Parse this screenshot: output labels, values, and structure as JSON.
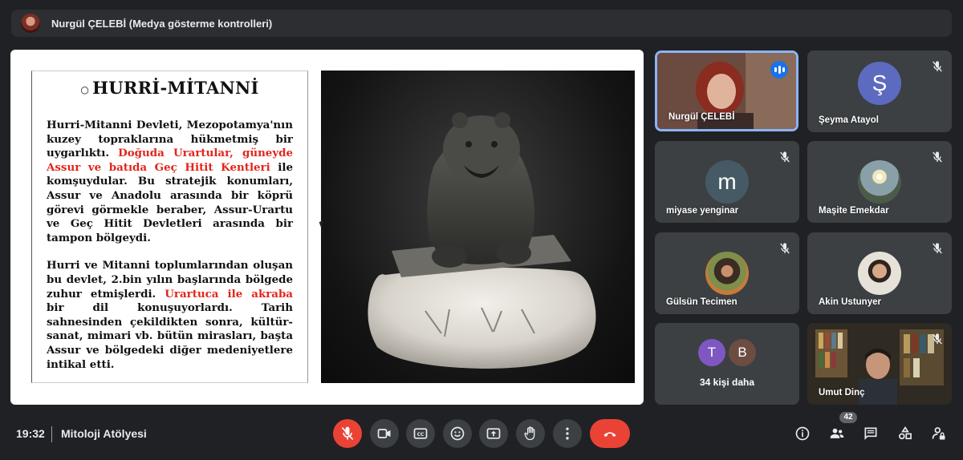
{
  "presenter_bar": {
    "title": "Nurgül ÇELEBİ (Medya gösterme kontrolleri)"
  },
  "slide": {
    "heading": "HURRİ-MİTANNİ",
    "para1": [
      {
        "text": "Hurri-Mitanni Devleti, Mezopotamya'nın kuzey topraklarına hükmetmiş bir uygarlıktı. ",
        "red": false
      },
      {
        "text": "Doğuda Urartular, güneyde Assur ve batıda Geç Hitit Kentleri",
        "red": true
      },
      {
        "text": " ile komşuydular. Bu stratejik konumları, Assur ve Anadolu arasında bir köprü görevi görmekle beraber, Assur-Urartu ve Geç Hitit Devletleri arasında bir tampon bölgeydi.",
        "red": false
      }
    ],
    "para2": [
      {
        "text": "Hurri ve Mitanni toplumlarından oluşan bu devlet, 2.bin yılın başlarında bölgede zuhur etmişlerdi. ",
        "red": false
      },
      {
        "text": "Urartuca ile akraba",
        "red": true
      },
      {
        "text": " bir dil konuşuyorlardı. Tarih sahnesinden çekildikten sonra, kültür-sanat, mimari vb. bütün mirasları, başta Assur ve bölgedeki diğer medeniyetlere intikal etti.",
        "red": false
      }
    ]
  },
  "participants": [
    {
      "name": "Nurgül ÇELEBİ",
      "type": "photo",
      "speaking": true
    },
    {
      "name": "Şeyma Atayol",
      "type": "letter",
      "letter": "Ş",
      "color": "#5c6bc0",
      "muted": true
    },
    {
      "name": "miyase yenginar",
      "type": "letter",
      "letter": "m",
      "color": "#455a64",
      "muted": true
    },
    {
      "name": "Maşite Emekdar",
      "type": "photo-circle",
      "muted": true
    },
    {
      "name": "Gülsün Tecimen",
      "type": "photo-circle",
      "muted": true
    },
    {
      "name": "Akin Ustunyer",
      "type": "photo-circle",
      "muted": true
    },
    {
      "name": "Umut Dinç",
      "type": "video",
      "muted": true
    }
  ],
  "more_tile": {
    "label": "34 kişi daha",
    "avatars": [
      {
        "letter": "T",
        "color": "#7e57c2"
      },
      {
        "letter": "B",
        "color": "#6d4c41"
      }
    ]
  },
  "bottom_bar": {
    "time": "19:32",
    "meeting_name": "Mitoloji Atölyesi",
    "participant_count": "42"
  },
  "colors": {
    "background": "#202124",
    "tile": "#3c4043",
    "accent_red": "#ea4335",
    "active_border": "#8ab4f8",
    "slide_red_text": "#e3251c"
  }
}
